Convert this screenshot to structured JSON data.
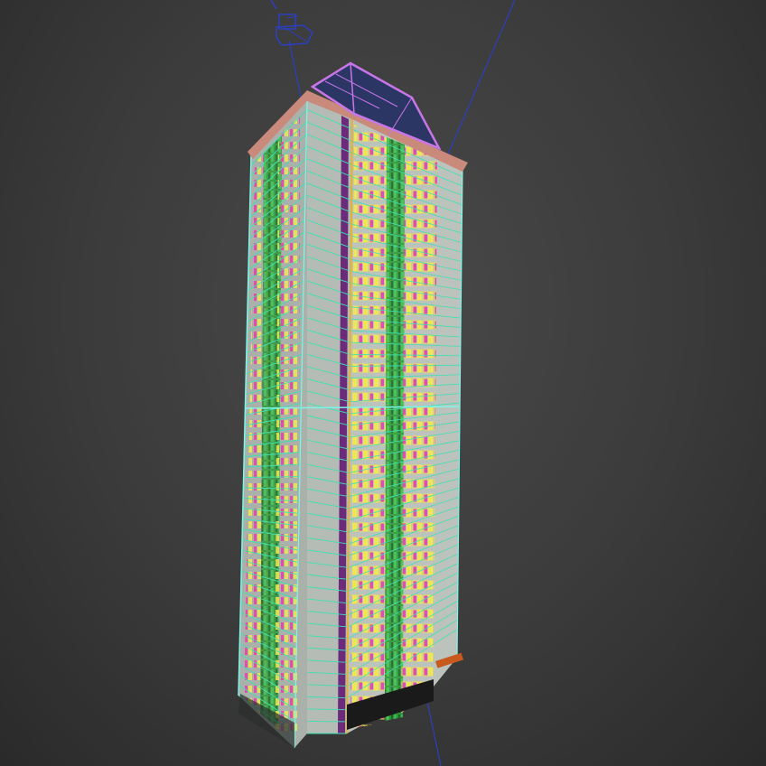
{
  "viewport": {
    "background": "#3d3d3d"
  },
  "scene": {
    "object": "highrise-tower-wireframe",
    "colors": {
      "facade_front": "#b7bfb8",
      "facade_side": "#a9b1aa",
      "floor_lines": "#3fe0b2",
      "window_pink": "#e24bb0",
      "window_yellow": "#f3ea4a",
      "glass_green": "#2e9a3c",
      "edge_cyan": "#7ff5e8",
      "roof_purple": "#c875e8",
      "roof_glass": "#2a3568",
      "cornice": "#c98a7c",
      "camera_lines": "#2c3fbf",
      "base_dark": "#1a1a1a",
      "orange_accent": "#c85a1e"
    },
    "icons": [
      "camera-icon",
      "target-line"
    ]
  }
}
